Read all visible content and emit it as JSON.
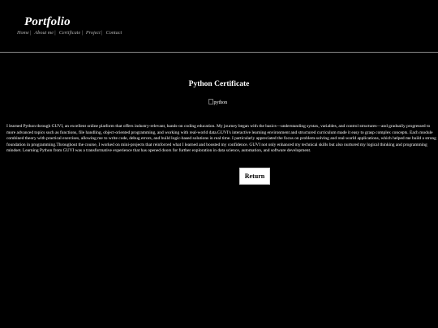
{
  "header": {
    "logo": "Portfolio",
    "nav": [
      {
        "label": "Home"
      },
      {
        "label": "About me"
      },
      {
        "label": "Certificate"
      },
      {
        "label": "Project"
      },
      {
        "label": "Contact"
      }
    ],
    "separator": "|"
  },
  "main": {
    "title": "Python Certificate",
    "image_alt": "python",
    "paragraph": "I learned Python through GUVI, an excellent online platform that offers industry-relevant, hands-on coding education. My journey began with the basics—understanding syntax, variables, and control structures—and gradually progressed to more advanced topics such as functions, file handling, object-oriented programming, and working with real-world data.GUVI's interactive learning environment and structured curriculum made it easy to grasp complex concepts. Each module combined theory with practical exercises, allowing me to write code, debug errors, and build logic-based solutions in real time. I particularly appreciated the focus on problem-solving and real-world applications, which helped me build a strong foundation in programming.Throughout the course, I worked on mini-projects that reinforced what I learned and boosted my confidence. GUVI not only enhanced my technical skills but also nurtured my logical thinking and programming mindset. Learning Python from GUVI was a transformative experience that has opened doors for further exploration in data science, automation, and software development.",
    "return_label": "Return"
  },
  "colors": {
    "background": "#000000",
    "text": "#ffffff",
    "nav_text": "#b0b0b0",
    "divider": "#8a8a8a",
    "button_bg": "#ffffff",
    "button_text": "#000000"
  }
}
